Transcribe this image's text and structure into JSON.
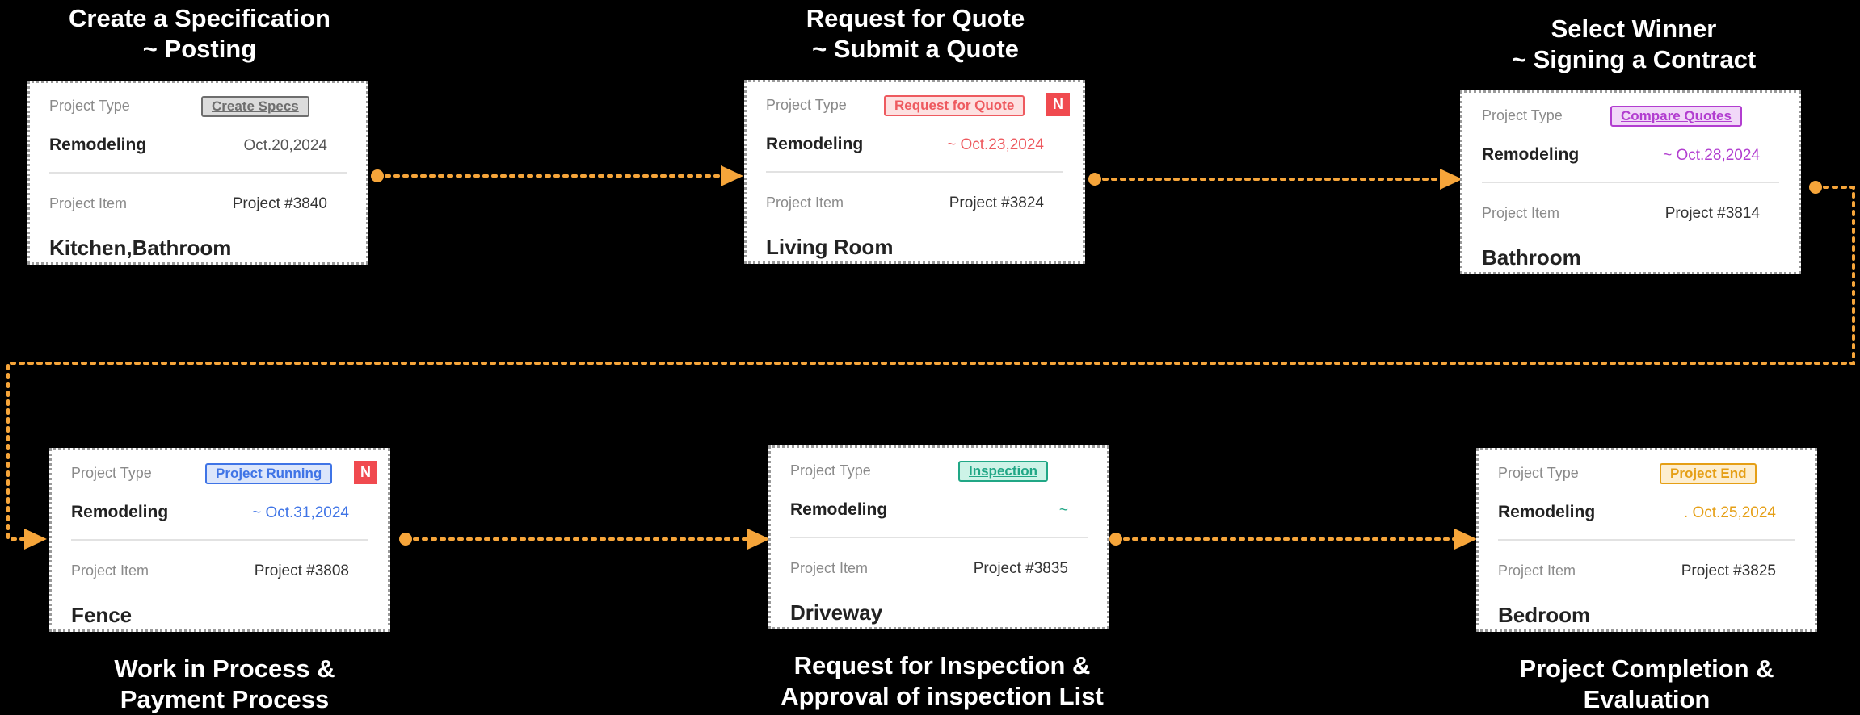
{
  "labels": {
    "project_type": "Project Type",
    "project_item": "Project Item",
    "new_badge": "N"
  },
  "stages": [
    {
      "title_line1": "Create a Specification",
      "title_line2": "~ Posting",
      "badge": "Create Specs",
      "badge_color": "#6e6e6e",
      "badge_bg": "#dcdcdc",
      "category": "Remodeling",
      "date": "Oct.20,2024",
      "date_color": "#555555",
      "project": "Project #3840",
      "room": "Kitchen,Bathroom",
      "is_new": false
    },
    {
      "title_line1": "Request for Quote",
      "title_line2": "~ Submit a Quote",
      "badge": "Request for Quote",
      "badge_color": "#ee5a5f",
      "badge_bg": "#fde1e1",
      "category": "Remodeling",
      "date": "~ Oct.23,2024",
      "date_color": "#ee5a5f",
      "project": "Project #3824",
      "room": "Living Room",
      "is_new": true
    },
    {
      "title_line1": "Select Winner",
      "title_line2": "~ Signing a Contract",
      "badge": "Compare Quotes",
      "badge_color": "#b23ed0",
      "badge_bg": "#f1d8f8",
      "category": "Remodeling",
      "date": "~ Oct.28,2024",
      "date_color": "#b23ed0",
      "project": "Project #3814",
      "room": "Bathroom",
      "is_new": false
    },
    {
      "title_line1": "Work in Process &",
      "title_line2": "Payment Process",
      "badge": "Project Running",
      "badge_color": "#3f74e6",
      "badge_bg": "#dce6fb",
      "category": "Remodeling",
      "date": "~ Oct.31,2024",
      "date_color": "#3f74e6",
      "project": "Project #3808",
      "room": "Fence",
      "is_new": true
    },
    {
      "title_line1": "Request for Inspection &",
      "title_line2": "Approval of inspection List",
      "badge": "Inspection",
      "badge_color": "#21a786",
      "badge_bg": "#cdf3e7",
      "category": "Remodeling",
      "date": "~",
      "date_color": "#21a786",
      "project": "Project #3835",
      "room": "Driveway",
      "is_new": false
    },
    {
      "title_line1": "Project Completion &",
      "title_line2": "Evaluation",
      "badge": "Project End",
      "badge_color": "#e59f16",
      "badge_bg": "#fdeed0",
      "category": "Remodeling",
      "date": ". Oct.25,2024",
      "date_color": "#e59f16",
      "project": "Project #3825",
      "room": "Bedroom",
      "is_new": false
    }
  ],
  "connector_color": "#f6a53a"
}
